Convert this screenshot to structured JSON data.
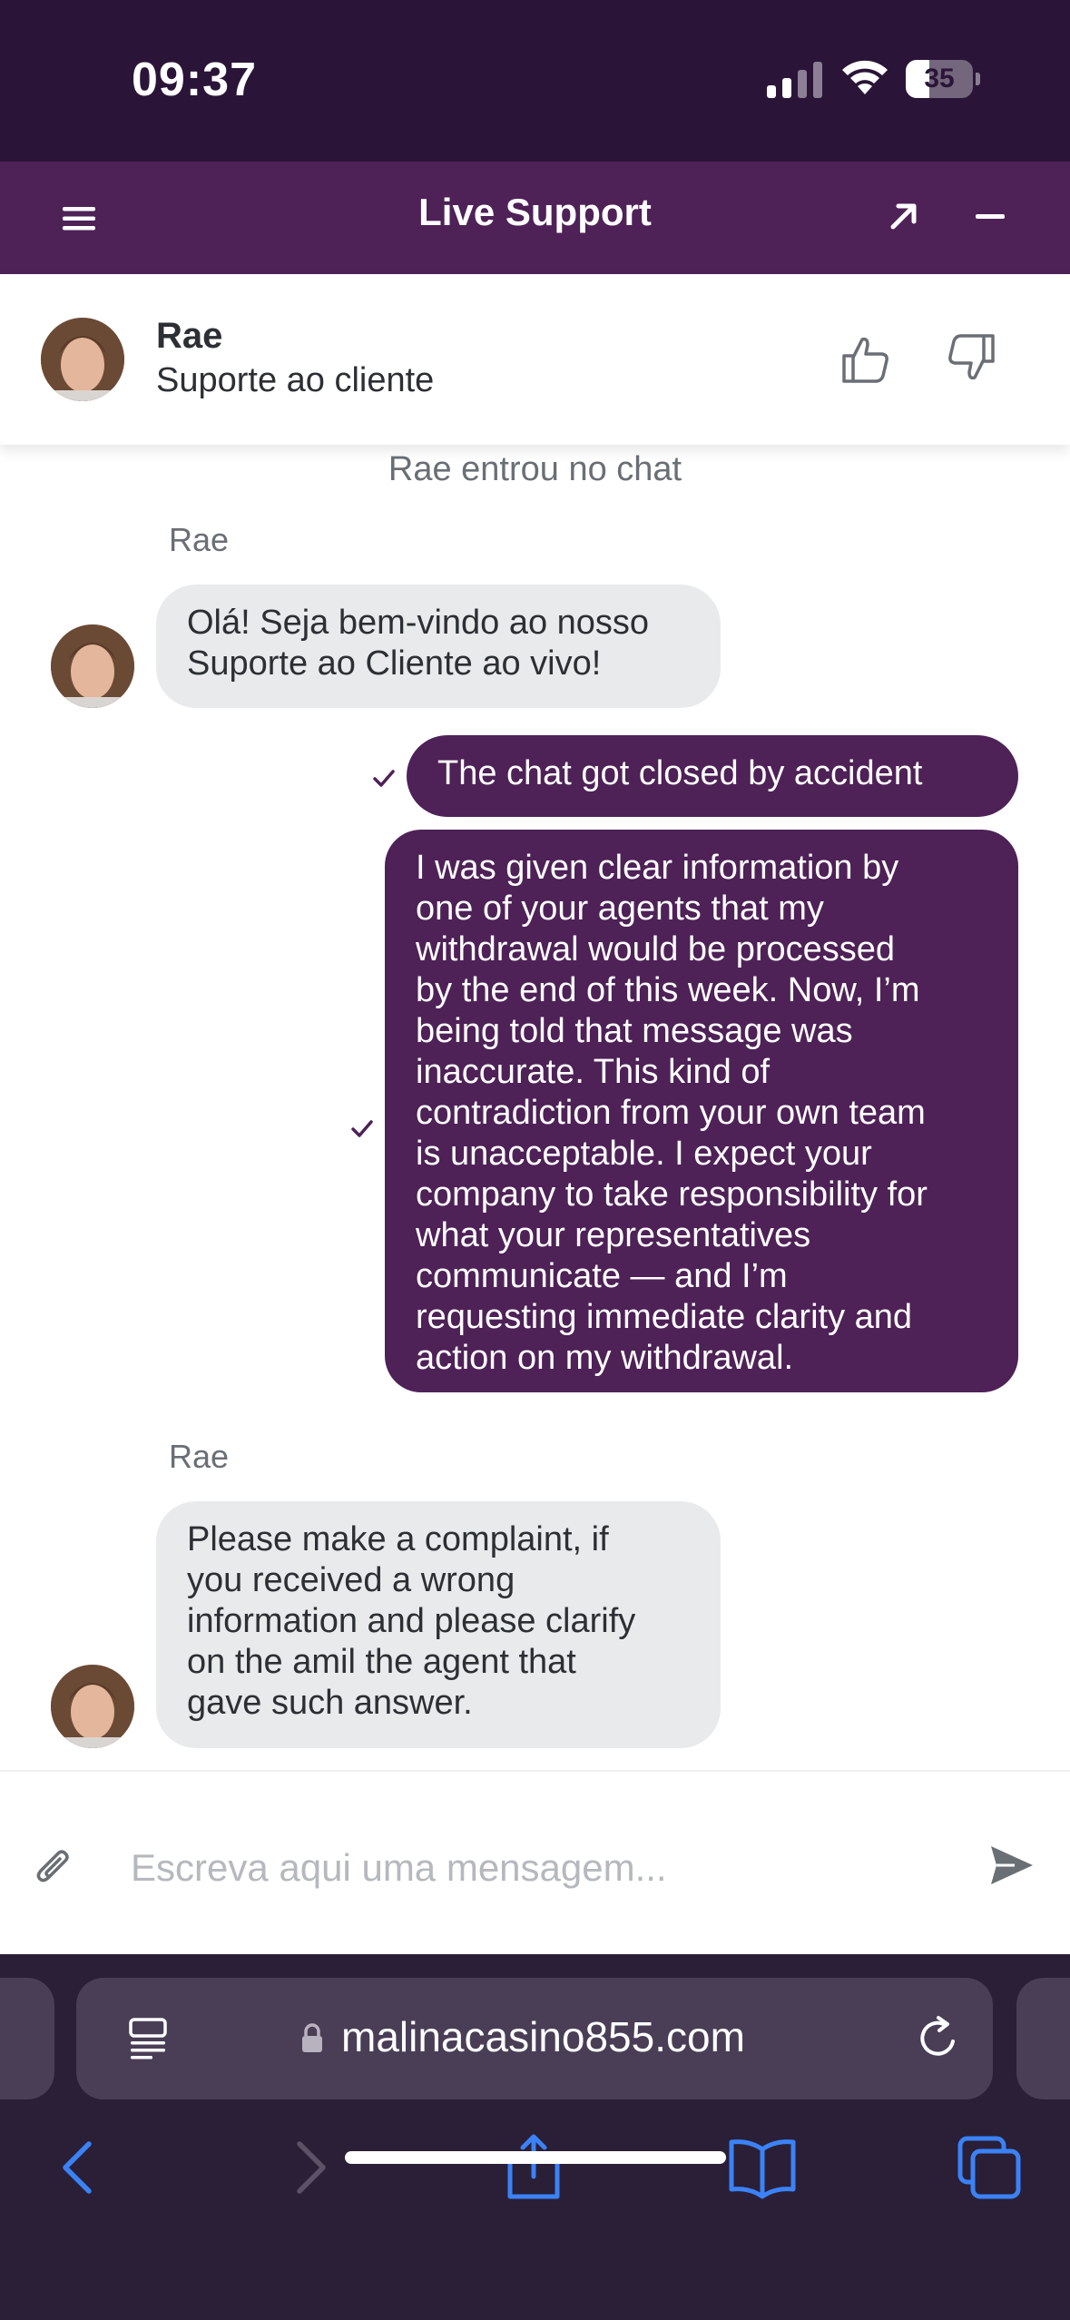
{
  "status_bar": {
    "time": "09:37",
    "battery": "35",
    "battery_level": 0.35
  },
  "header": {
    "title": "Live Support"
  },
  "agent": {
    "name": "Rae",
    "role": "Suporte ao cliente"
  },
  "chat": {
    "system_message": "Rae entrou no chat",
    "messages": [
      {
        "sender": "Rae",
        "text": "Olá! Seja bem-vindo ao nosso\nSuporte ao Cliente ao vivo!"
      },
      {
        "text": "The chat got closed by accident"
      },
      {
        "text": "I was given clear information by\none of your agents that my\nwithdrawal would be processed\nby the end of this week. Now, I’m\nbeing told that message was\ninaccurate. This kind of\ncontradiction from your own team\nis unacceptable. I expect your\ncompany to take responsibility for\nwhat your representatives\ncommunicate — and I’m\nrequesting immediate clarity and\naction on my withdrawal."
      },
      {
        "sender": "Rae",
        "text": "Please make a complaint, if\nyou received a wrong\ninformation and please clarify\non the amil the agent that\ngave such answer."
      }
    ]
  },
  "composer": {
    "placeholder": "Escreva aqui uma mensagem..."
  },
  "browser": {
    "url": "malinacasino855.com"
  },
  "icons": {
    "menu": "hamburger-icon",
    "expand": "arrow-up-right-icon",
    "minimize": "minus-icon",
    "thumb_up": "thumbs-up-icon",
    "thumb_down": "thumbs-down-icon",
    "attach": "paperclip-icon",
    "send": "send-icon",
    "read_receipt": "checkmark-icon"
  },
  "colors": {
    "header": "#4e2157",
    "status_bar": "#2a1538",
    "outgoing_bubble": "#4e2157",
    "incoming_bubble": "#e9eaec",
    "browser_chrome": "#2a1f36",
    "browser_accent": "#3b82f6"
  }
}
